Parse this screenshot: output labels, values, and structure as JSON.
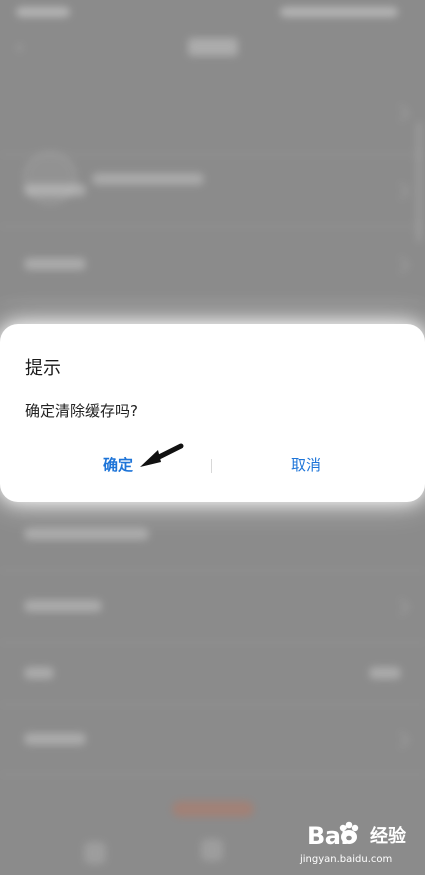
{
  "dialog": {
    "title": "提示",
    "message": "确定清除缓存吗?",
    "confirm_label": "确定",
    "cancel_label": "取消"
  },
  "watermark": {
    "brand": "Bai",
    "brand_suffix": "经验",
    "url": "jingyan.baidu.com"
  },
  "colors": {
    "accent": "#1d74d8",
    "dialog_background": "#ffffff",
    "overlay": "#8b8b8b"
  }
}
